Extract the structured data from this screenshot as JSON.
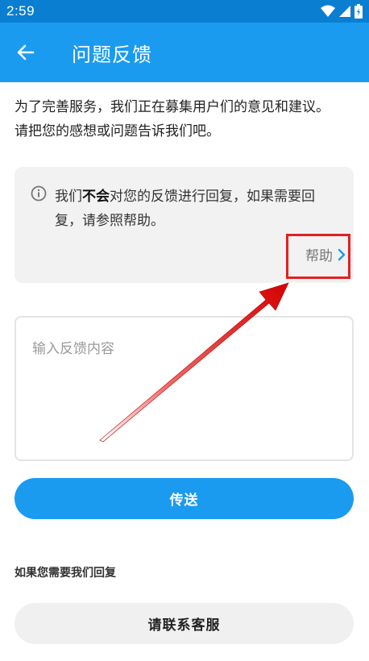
{
  "status_bar": {
    "time": "2:59",
    "icons": [
      "wifi-icon",
      "signal-icon",
      "battery-icon"
    ]
  },
  "app_bar": {
    "title": "问题反馈",
    "back_icon": "arrow-left-icon"
  },
  "intro": {
    "line1": "为了完善服务，我们正在募集用户们的意见和建议。",
    "line2": "请把您的感想或问题告诉我们吧。"
  },
  "notice": {
    "icon": "info-icon",
    "text_prefix": "我们",
    "text_bold": "不会",
    "text_suffix": "对您的反馈进行回复，如果需要回复，请参照帮助。",
    "help_label": "帮助",
    "help_icon": "chevron-right-icon"
  },
  "feedback": {
    "placeholder": "输入反馈内容",
    "value": ""
  },
  "send_button": {
    "label": "传送"
  },
  "reply_section": {
    "label": "如果您需要我们回复",
    "contact_label": "请联系客服"
  },
  "colors": {
    "status_bar": "#0a7fd1",
    "primary": "#1a9bf0",
    "highlight": "#e32020",
    "card_bg": "#f2f2f2"
  }
}
